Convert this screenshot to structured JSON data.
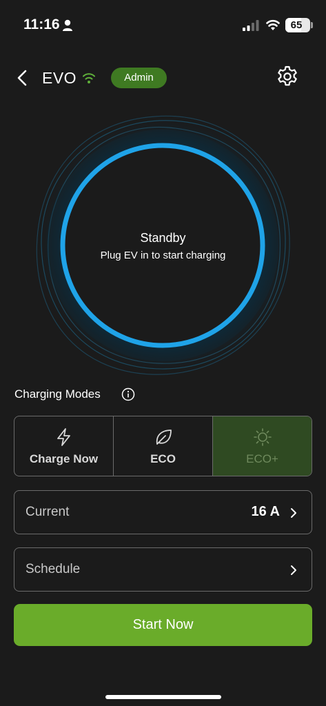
{
  "status_bar": {
    "time": "11:16",
    "battery_percent": "65",
    "battery_level": 0.65
  },
  "header": {
    "device_name": "EVO",
    "role_badge": "Admin",
    "icons": [
      "back-icon",
      "wifi-icon",
      "settings-icon"
    ]
  },
  "charger_status": {
    "title": "Standby",
    "subtitle": "Plug EV in to start charging",
    "ring_color": "#1fa3e8"
  },
  "charging_modes": {
    "label": "Charging Modes",
    "options": [
      {
        "label": "Charge Now",
        "icon": "lightning-icon",
        "selected": false
      },
      {
        "label": "ECO",
        "icon": "leaf-icon",
        "selected": false
      },
      {
        "label": "ECO+",
        "icon": "sun-icon",
        "selected": true
      }
    ]
  },
  "settings_rows": {
    "current": {
      "label": "Current",
      "value": "16 A"
    },
    "schedule": {
      "label": "Schedule",
      "value": ""
    }
  },
  "actions": {
    "start_label": "Start Now"
  },
  "colors": {
    "background": "#1b1b1b",
    "accent_green": "#6aac2a",
    "badge_green": "#3f7a22",
    "selected_mode": "#2f4a22",
    "ring_blue": "#1fa3e8"
  }
}
